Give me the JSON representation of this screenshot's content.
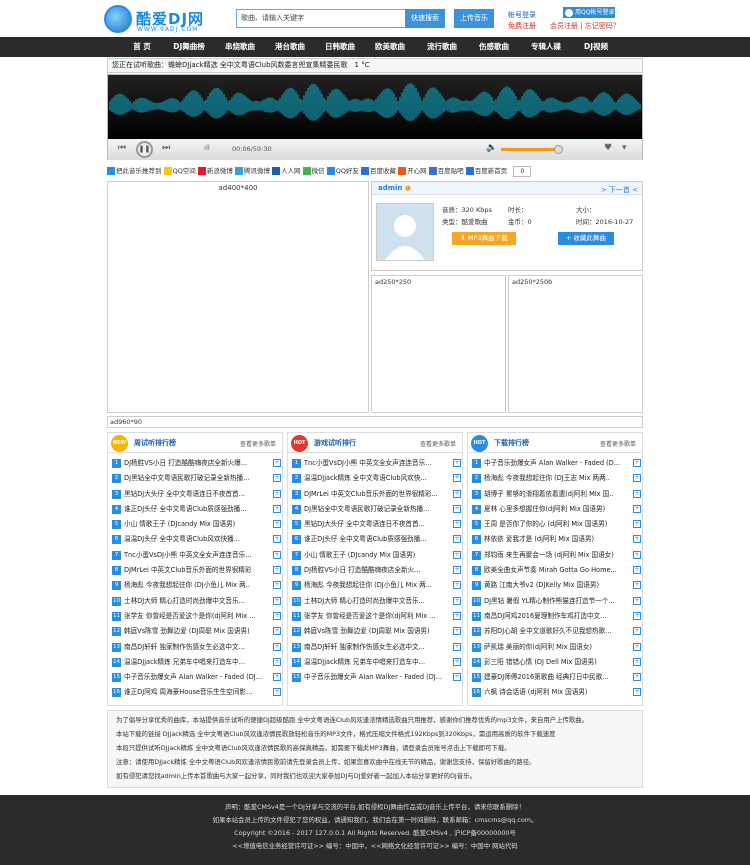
{
  "header": {
    "brand": "酷爱DJ网",
    "brand_url": "WWW.9ADJ.COM",
    "search_placeholder": "歌曲、请输入关键字",
    "search_button": "快速搜索",
    "upload_button": "上传音乐",
    "login_link": "帐号登录",
    "register_link": "免费注册",
    "qq_login": "用QQ帐号登录",
    "member_register": "会员注册",
    "forgot_password": "忘记密码？"
  },
  "nav": [
    "首 页",
    "DJ舞曲榜",
    "串烧歌曲",
    "港台歌曲",
    "日韩歌曲",
    "欧美歌曲",
    "流行歌曲",
    "伤感歌曲",
    "专辑人碟",
    "DJ视频"
  ],
  "notice": "您正在试听歌曲：蟾蜍DJjack精选 全中文粤语Club风数委言兜宣集精委民歌　1 °C",
  "player": {
    "time": "00:06/59:30",
    "volume_level": 0.75
  },
  "share": {
    "items": [
      "把此音乐推荐到",
      "QQ空间",
      "新浪微博",
      "腾讯微博",
      "人人网",
      "微信",
      "QQ好友",
      "百度收藏",
      "开心网",
      "百度贴吧",
      "百度新首页"
    ],
    "count": "0"
  },
  "ad_left": "ad400*400",
  "song": {
    "uploader": "admin",
    "next": "> 下一首 <",
    "quality": "音质：320 Kbps",
    "duration": "时长：",
    "size": "大小：",
    "category": "类型：酷爱歌曲",
    "gold": "金币：0",
    "date": "时间：2016-10-27",
    "download_button": "MP3舞曲下载",
    "favorite_button": "收藏此舞曲"
  },
  "ad_mid_a": "ad250*250",
  "ad_mid_b": "ad250*250b",
  "ad_wide": "ad960*90",
  "rankings": [
    {
      "badge": "NEW",
      "title": "周试听排行榜",
      "more": "查看更多歌单",
      "items": [
        "DJ杨胜VS小日 打造酷酷嗨夜店全新火爆...",
        "DJ黑钻全中文粤语民歌打破记录全新热播...",
        "黑钻DJ大头仔 全中文粤语连日不夜首首...",
        "谁正DJ头仔 全中文粤语Club质感强劲播...",
        "小山 情歌王子 (DJcandy Mix 国语男)",
        "温温DJ头仔 全中文粤语Club风欢快播...",
        "Tnc小蛋VsDJ小熊 中英文全女声连连音乐...",
        "DJMrLei 中英文Club音乐外面的世界很精彩",
        "杨海彪 今夜我想起往你 (DJ小鱼儿 Mix 两..",
        "土林DJ大师 精心打造时尚劲爆中文音乐...",
        "张学友 你曾经是否爱这个是你(dj阿利 Mix ...",
        "韩庭Vs陈雪 劲舞边爱 (DJ周聪 Mix 国语男)",
        "南昌DJ轩轩 独家制作伤感女生必选中文...",
        "温温DJjack精炼 兄弟车中唱来打造车中...",
        "中子音乐劲爆女声 Alan Walker - Faded (DJ...",
        "谁正DJ阿鸡 周海豪House音乐生生空间影..."
      ]
    },
    {
      "badge": "HOT",
      "title": "游戏试听排行",
      "more": "查看更多歌单",
      "items": [
        "Tnc小蛋VsDJ小熊 中英文全女声连连音乐...",
        "温温DJjack精炼 全中文粤语Club风欢快...",
        "DJMrLei 中英文Club音乐外面的世界很精彩...",
        "DJ黑钻全中文粤语民歌打破记录全新热播...",
        "黑钻DJ大头仔 全中文粤语连日不夜首首...",
        "谁正DJ头仔 全中文粤语Club质感强劲播...",
        "小山 情歌王子 (DJcandy Mix 国语男)",
        "DJ杨胜VS小日 打造酷酷嗨夜店全新火...",
        "杨海彪 今夜我想起往你 (DJ小鱼儿 Mix 两...",
        "土林DJ大师 精心打造时尚劲爆中文音乐...",
        "张学友 你曾经是否爱这个是你(dj阿利 Mix ...",
        "韩庭Vs陈雪 劲舞边爱 (DJ周聪 Mix 国语男)",
        "南昌DJ轩轩 独家制作伤感女生必选中文...",
        "温温DJjack精炼 兄弟车中唱来打造车中...",
        "中子音乐劲爆女声 Alan Walker - Faded (DJ..."
      ]
    },
    {
      "badge": "HOT",
      "title": "下载排行榜",
      "more": "查看更多歌单",
      "items": [
        "中子音乐劲爆女声 Alan Walker - Faded (D...",
        "杨海彪 今夜我想起往你 (DJ王志 Mix 两两..",
        "胡博子 累够的滑翔着依着遗(dj阿利 Mix 国..",
        "夏林 心里多想握住你(dj阿利 Mix 国语男)",
        "王周 是否你了你的心 (dj阿利 Mix 国语男)",
        "林依依 爱我才是 (dj阿利 Mix 国语男)",
        "郑钧雨 来生再聚会一场 (dj阿利 Mix 国语女)",
        "欧美全曲女声节奏 Mirah Gotta Go Home...",
        "黄路 江南大爷v2 (DJKelly Mix 国语男)",
        "DJ黑钻 暑假 YL精心制作熊猫连打造节一个...",
        "南昌DJ阿鸡2016夏理制作车鸡打造中文...",
        "苏阳DJ心胡 全中文道歌好久不见我想热歌...",
        "萨凯瑞 美丽的你(dj阿利 Mix 国语女)",
        "彭三阳 错错心情 (DJ Dell Mix 国语男)",
        "建豪DJ师傅2016第歌曲 经典打日中民歌...",
        "六枫 诗会话语 (dj阿利 Mix 国语男)"
      ]
    }
  ],
  "description": [
    "为了倡导分享优秀的曲库，本站提供音乐试听的便捷DJ超级酷跑 全中文粤语连Club风欢逢浓情精选歌曲只用推荐，感谢你们推荐优秀的mp3文件，来自用户上传歌曲。",
    "本站下载的链接 DJjack精选 全中文粤语Club风欢逢浓情民歌放轻松音乐的MP3文件，格式压缩文件格式192Kbps到320Kbps，需运用高质的软件下载速度",
    "本段只提供试听DJjack精炼 全中文粤语Club风欢逢浓情民歌的高保真精品，如需要下载此MP3舞曲，请登录会员账号点击上下载即可下载。",
    "注意：请使用DJjack精炼 全中文粤语Club风欢逢浓情民歌前请先登录会员上传，如果您喜欢曲中在线无节的精品，谢谢您支持，保留好歌曲的路径。",
    "如有侵犯请您找admin上传本首歌曲与大家一起分享，同时我们也欢迎大家参加DJ与DJ爱好者一起加入本站分享更好的DJ音乐。"
  ],
  "footer": [
    "声明：酷爱CMSv4是一个DJ分享与交流的平台,如有侵权DJ舞曲作品或DJ音乐上传平台，请来信联系删除！",
    "如果本站会员上传的文件侵犯了您的权益，请通知我们，我们会在第一时间删除，联系邮箱：cmscms@qq.com。",
    "Copyright ©2016 - 2017 127.0.0.1 All Rights Reserved. 酷爱CMSv4 , 沪ICP备00000000号",
    "<<增值电信业务经营许可证>> 编号：中国中，<<网络文化经营许可证>> 编号：中国中 网站代码"
  ],
  "colors": {
    "accent": "#3d93db",
    "nav_bg": "#2b2b2b",
    "wave": "#0fb8d8",
    "download": "#f5a623"
  }
}
